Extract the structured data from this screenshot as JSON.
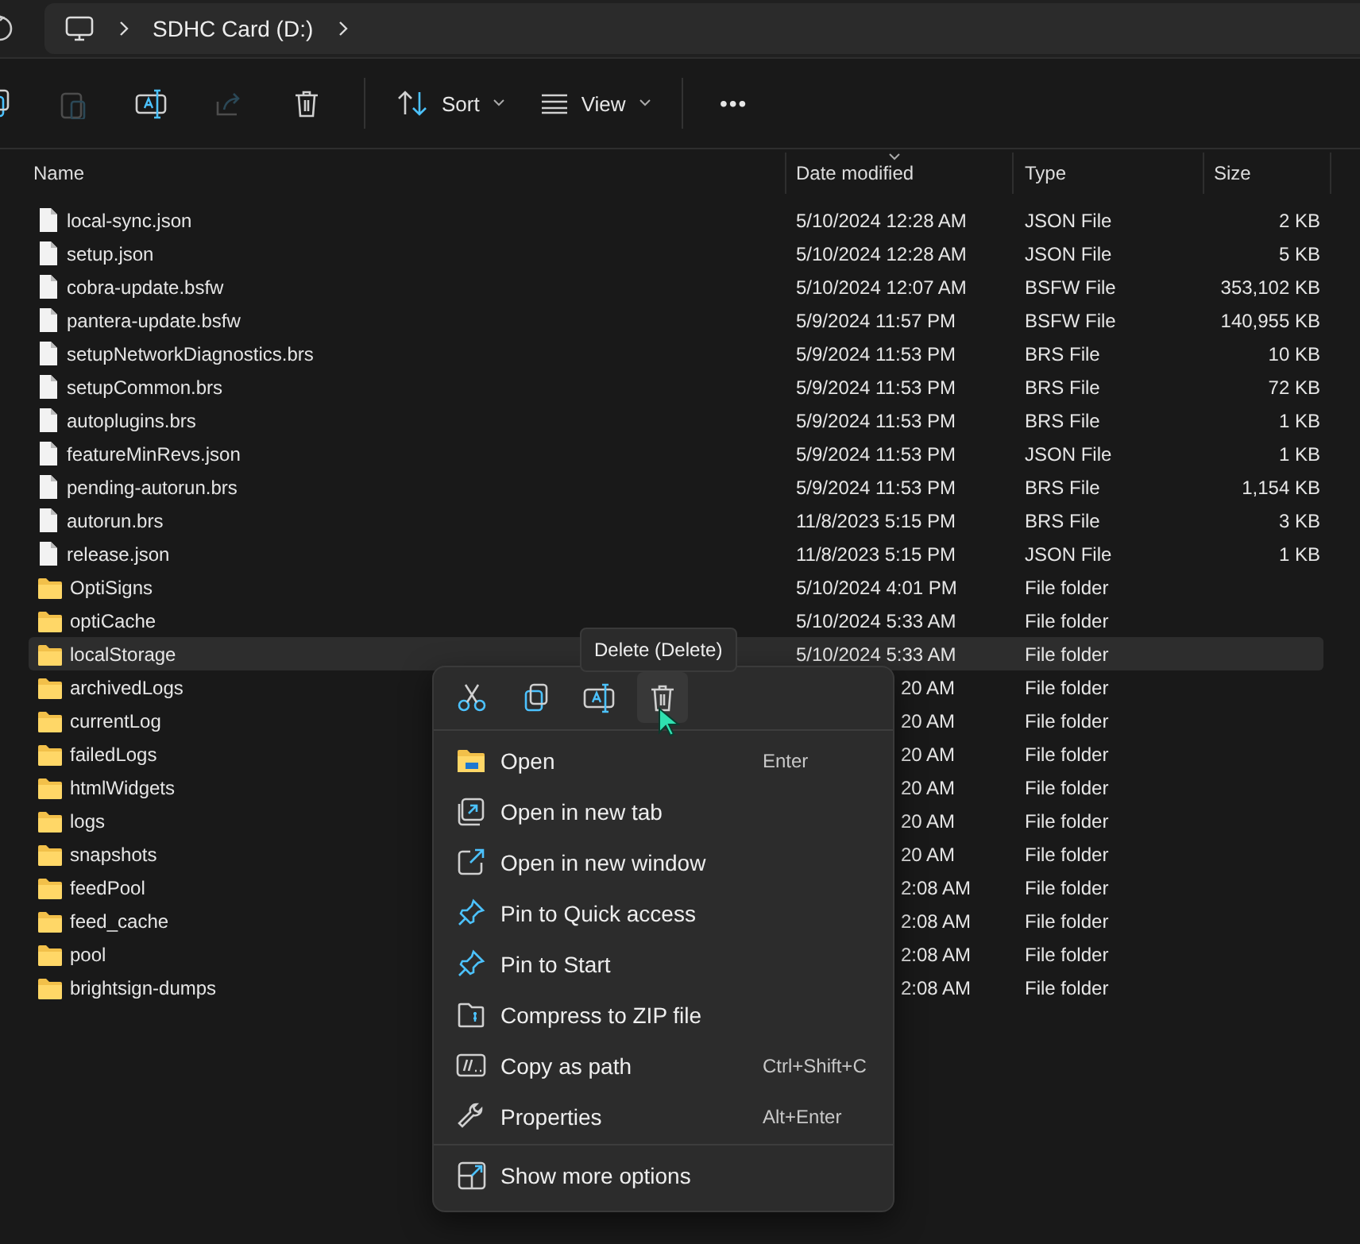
{
  "address_bar": {
    "segments": [
      "SDHC Card (D:)"
    ]
  },
  "toolbar": {
    "buttons": [
      {
        "kind": "copy",
        "disabled": false
      },
      {
        "kind": "paste",
        "disabled": true
      },
      {
        "kind": "rename",
        "disabled": false
      },
      {
        "kind": "share",
        "disabled": true
      },
      {
        "kind": "delete",
        "disabled": false
      }
    ],
    "sort": "Sort",
    "view": "View",
    "more": "•••"
  },
  "table": {
    "columns": [
      {
        "label": "Name",
        "sorted": false
      },
      {
        "label": "Date modified",
        "sorted": true
      },
      {
        "label": "Type",
        "sorted": false
      },
      {
        "label": "Size",
        "sorted": false
      }
    ],
    "rows": [
      {
        "kind": "file",
        "name": "local-sync.json",
        "date": "5/10/2024 12:28 AM",
        "date_cut": false,
        "type": "JSON File",
        "size": "2 KB",
        "selected": false
      },
      {
        "kind": "file",
        "name": "setup.json",
        "date": "5/10/2024 12:28 AM",
        "date_cut": false,
        "type": "JSON File",
        "size": "5 KB",
        "selected": false
      },
      {
        "kind": "file",
        "name": "cobra-update.bsfw",
        "date": "5/10/2024 12:07 AM",
        "date_cut": false,
        "type": "BSFW File",
        "size": "353,102 KB",
        "selected": false
      },
      {
        "kind": "file",
        "name": "pantera-update.bsfw",
        "date": "5/9/2024 11:57 PM",
        "date_cut": false,
        "type": "BSFW File",
        "size": "140,955 KB",
        "selected": false
      },
      {
        "kind": "file",
        "name": "setupNetworkDiagnostics.brs",
        "date": "5/9/2024 11:53 PM",
        "date_cut": false,
        "type": "BRS File",
        "size": "10 KB",
        "selected": false
      },
      {
        "kind": "file",
        "name": "setupCommon.brs",
        "date": "5/9/2024 11:53 PM",
        "date_cut": false,
        "type": "BRS File",
        "size": "72 KB",
        "selected": false
      },
      {
        "kind": "file",
        "name": "autoplugins.brs",
        "date": "5/9/2024 11:53 PM",
        "date_cut": false,
        "type": "BRS File",
        "size": "1 KB",
        "selected": false
      },
      {
        "kind": "file",
        "name": "featureMinRevs.json",
        "date": "5/9/2024 11:53 PM",
        "date_cut": false,
        "type": "JSON File",
        "size": "1 KB",
        "selected": false
      },
      {
        "kind": "file",
        "name": "pending-autorun.brs",
        "date": "5/9/2024 11:53 PM",
        "date_cut": false,
        "type": "BRS File",
        "size": "1,154 KB",
        "selected": false
      },
      {
        "kind": "file",
        "name": "autorun.brs",
        "date": "11/8/2023 5:15 PM",
        "date_cut": false,
        "type": "BRS File",
        "size": "3 KB",
        "selected": false
      },
      {
        "kind": "file",
        "name": "release.json",
        "date": "11/8/2023 5:15 PM",
        "date_cut": false,
        "type": "JSON File",
        "size": "1 KB",
        "selected": false
      },
      {
        "kind": "folder",
        "name": "OptiSigns",
        "date": "5/10/2024 4:01 PM",
        "date_cut": false,
        "type": "File folder",
        "selected": false
      },
      {
        "kind": "folder",
        "name": "optiCache",
        "date": "5/10/2024 5:33 AM",
        "date_cut": false,
        "type": "File folder",
        "selected": false
      },
      {
        "kind": "folder",
        "name": "localStorage",
        "date": "5/10/2024 5:33 AM",
        "date_cut": false,
        "type": "File folder",
        "selected": true
      },
      {
        "kind": "folder",
        "name": "archivedLogs",
        "date": "20 AM",
        "date_cut": true,
        "type": "File folder",
        "selected": false
      },
      {
        "kind": "folder",
        "name": "currentLog",
        "date": "20 AM",
        "date_cut": true,
        "type": "File folder",
        "selected": false
      },
      {
        "kind": "folder",
        "name": "failedLogs",
        "date": "20 AM",
        "date_cut": true,
        "type": "File folder",
        "selected": false
      },
      {
        "kind": "folder",
        "name": "htmlWidgets",
        "date": "20 AM",
        "date_cut": true,
        "type": "File folder",
        "selected": false
      },
      {
        "kind": "folder",
        "name": "logs",
        "date": "20 AM",
        "date_cut": true,
        "type": "File folder",
        "selected": false
      },
      {
        "kind": "folder",
        "name": "snapshots",
        "date": "20 AM",
        "date_cut": true,
        "type": "File folder",
        "selected": false
      },
      {
        "kind": "folder",
        "name": "feedPool",
        "date": "2:08 AM",
        "date_cut": true,
        "type": "File folder",
        "selected": false
      },
      {
        "kind": "folder",
        "name": "feed_cache",
        "date": "2:08 AM",
        "date_cut": true,
        "type": "File folder",
        "selected": false
      },
      {
        "kind": "folder",
        "name": "pool",
        "date": "2:08 AM",
        "date_cut": true,
        "type": "File folder",
        "selected": false
      },
      {
        "kind": "folder",
        "name": "brightsign-dumps",
        "date": "2:08 AM",
        "date_cut": true,
        "type": "File folder",
        "selected": false
      }
    ]
  },
  "context_menu": {
    "tooltip": "Delete (Delete)",
    "quick_actions": [
      {
        "kind": "cut",
        "hovered": false
      },
      {
        "kind": "copy",
        "hovered": false
      },
      {
        "kind": "rename",
        "hovered": false
      },
      {
        "kind": "delete",
        "hovered": true
      }
    ],
    "items": [
      {
        "kind": "open",
        "label": "Open",
        "shortcut": "Enter"
      },
      {
        "kind": "tab",
        "label": "Open in new tab"
      },
      {
        "kind": "window",
        "label": "Open in new window"
      },
      {
        "kind": "pin",
        "label": "Pin to Quick access"
      },
      {
        "kind": "pin",
        "label": "Pin to Start"
      },
      {
        "kind": "zip",
        "label": "Compress to ZIP file"
      },
      {
        "kind": "path",
        "label": "Copy as path",
        "shortcut": "Ctrl+Shift+C"
      },
      {
        "kind": "wrench",
        "label": "Properties",
        "shortcut": "Alt+Enter"
      }
    ],
    "footer": {
      "kind": "more",
      "label": "Show more options"
    }
  }
}
